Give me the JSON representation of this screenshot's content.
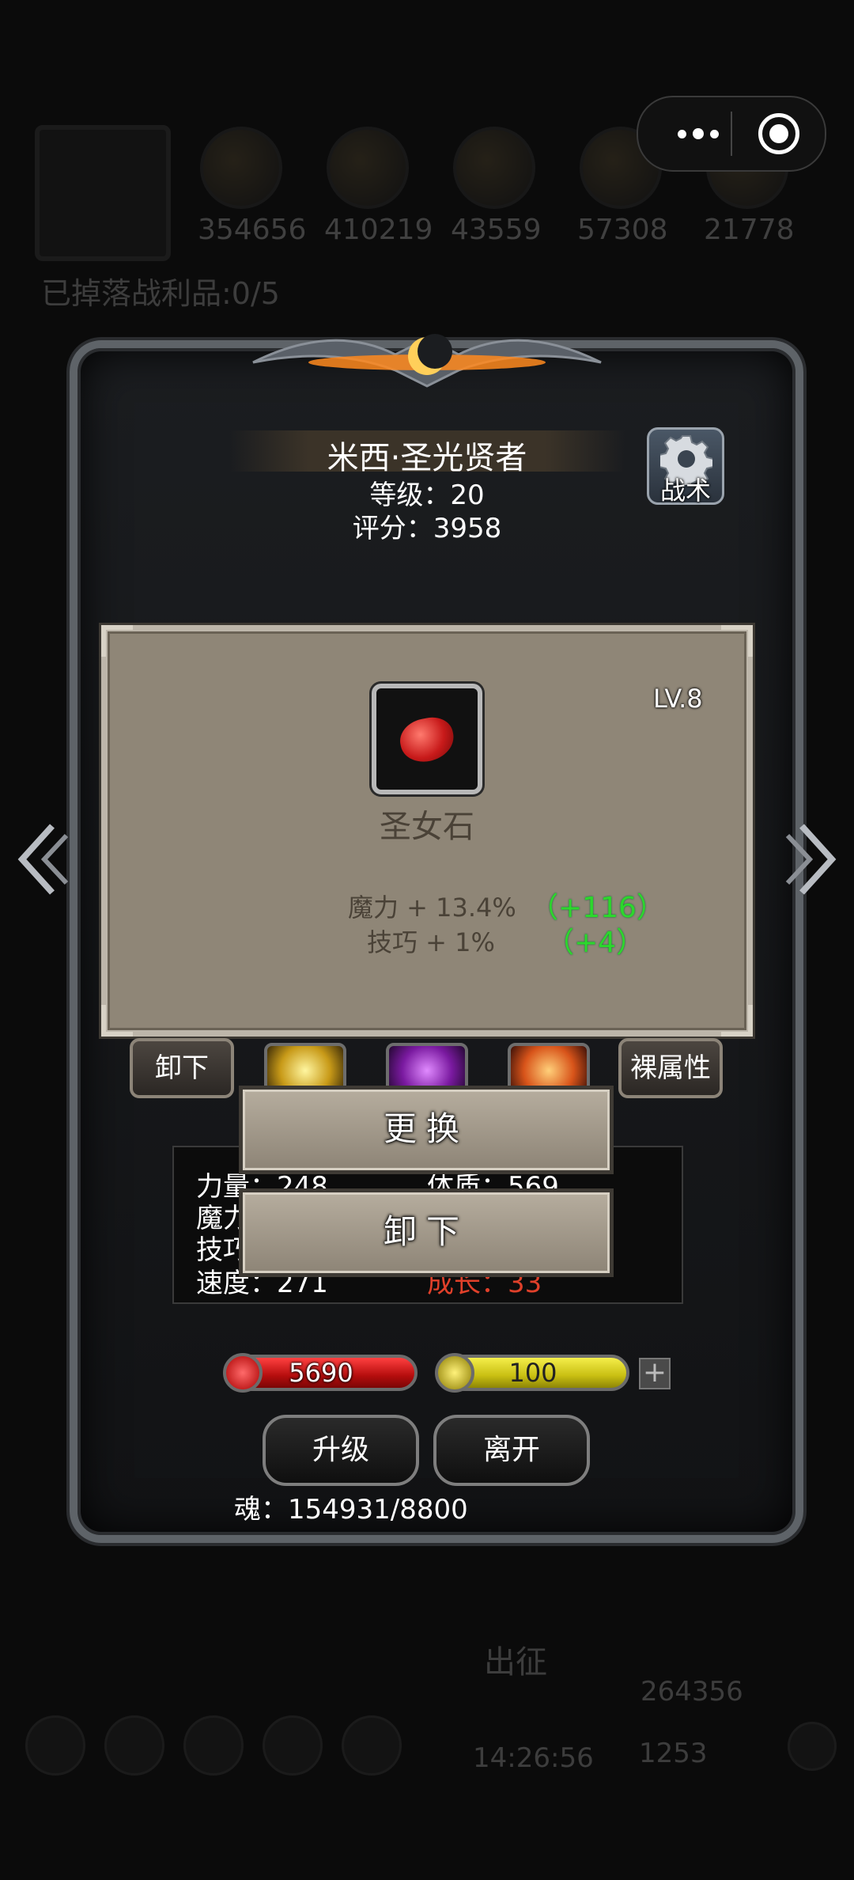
{
  "background": {
    "resources": [
      "354656",
      "410219",
      "43559",
      "57308",
      "21778"
    ],
    "loot_status": "已掉落战利品:0/5",
    "sortie_label": "出征",
    "timer": "14:26:56",
    "gold": "264356",
    "gems": "1253"
  },
  "capsule": {
    "more_icon": "more-dots-icon",
    "close_icon": "target-close-icon"
  },
  "hero": {
    "name": "米西·圣光贤者",
    "level": "等级：20",
    "score": "评分：3958",
    "tactics_label": "战术"
  },
  "item": {
    "level": "LV.8",
    "name": "圣女石",
    "icon": "red-gem-icon",
    "stats": [
      {
        "label": "魔力 + 13.4%",
        "bonus": "（+116）"
      },
      {
        "label": "技巧 + 1%",
        "bonus": "（+4）"
      }
    ]
  },
  "equip_row": {
    "unequip_label": "卸下",
    "base_attr_label": "裸属性"
  },
  "hero_stats": {
    "rows": [
      {
        "left": "力量：248",
        "right": "体质：569"
      },
      {
        "left": "魔力：",
        "right": ""
      },
      {
        "left": "技巧：",
        "right": ""
      },
      {
        "left": "速度：271",
        "right": "成长：33"
      }
    ]
  },
  "popup": {
    "replace_label": "更换",
    "unequip_label": "卸下"
  },
  "bars": {
    "hp": "5690",
    "energy": "100",
    "plus": "+"
  },
  "buttons": {
    "upgrade": "升级",
    "leave": "离开"
  },
  "soul": "魂：154931/8800",
  "colors": {
    "bonus_green": "#2cd82c",
    "hp_red": "#d01515",
    "energy_yellow": "#d8ce1a",
    "growth_red": "#e0402a"
  }
}
